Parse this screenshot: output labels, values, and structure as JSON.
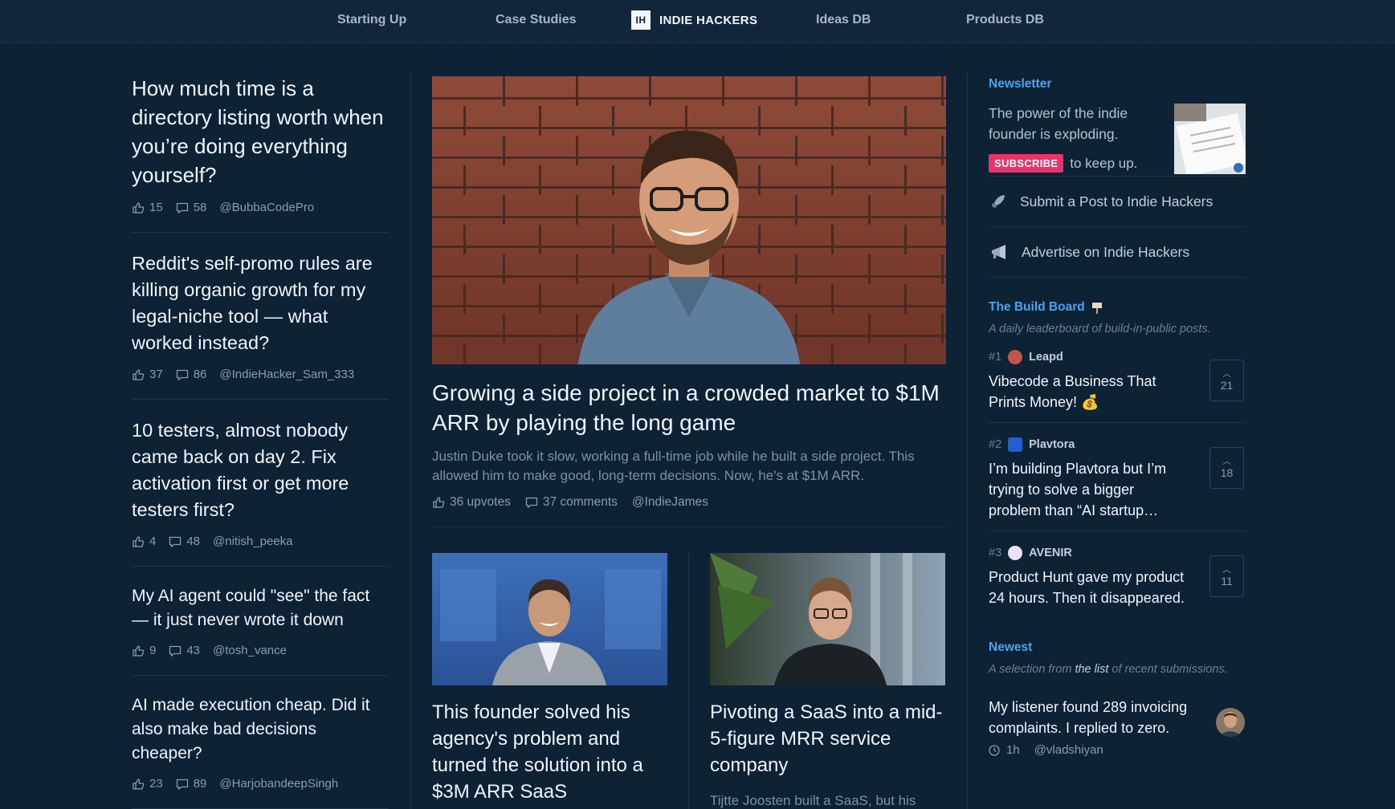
{
  "nav": {
    "starting_up": "Starting Up",
    "case_studies": "Case Studies",
    "brand_logo": "IH",
    "brand": "INDIE HACKERS",
    "ideas_db": "Ideas DB",
    "products_db": "Products DB"
  },
  "left_posts": [
    {
      "title": "How much time is a directory listing worth when you’re doing everything yourself?",
      "likes": "15",
      "comments": "58",
      "user": "@BubbaCodePro"
    },
    {
      "title": "Reddit's self-promo rules are killing organic growth for my legal-niche tool — what worked instead?",
      "likes": "37",
      "comments": "86",
      "user": "@IndieHacker_Sam_333"
    },
    {
      "title": "10 testers, almost nobody came back on day 2. Fix activation first or get more testers first?",
      "likes": "4",
      "comments": "48",
      "user": "@nitish_peeka"
    },
    {
      "title": "My AI agent could \"see\" the fact — it just never wrote it down",
      "likes": "9",
      "comments": "43",
      "user": "@tosh_vance"
    },
    {
      "title": "AI made execution cheap. Did it also make bad decisions cheaper?",
      "likes": "23",
      "comments": "89",
      "user": "@HarjobandeepSingh"
    }
  ],
  "hero": {
    "title": "Growing a side project in a crowded market to $1M ARR by playing the long game",
    "description": "Justin Duke took it slow, working a full-time job while he built a side project. This allowed him to make good, long-term decisions. Now, he's at $1M ARR.",
    "upvotes": "36 upvotes",
    "comments": "37 comments",
    "user": "@IndieJames"
  },
  "sub_cards": [
    {
      "title": "This founder solved his agency's problem and turned the solution into a $3M ARR SaaS"
    },
    {
      "title": "Pivoting a SaaS into a mid-5-figure MRR service company",
      "desc": "Tijtte Joosten built a SaaS, but his"
    }
  ],
  "sidebar": {
    "newsletter_label": "Newsletter",
    "newsletter_text": "The power of the indie founder is exploding.",
    "subscribe": "SUBSCRIBE",
    "keep_up": "to keep up.",
    "submit_link": "Submit a Post to Indie Hackers",
    "advertise_link": "Advertise on Indie Hackers",
    "build_board_label": "The Build Board",
    "build_board_sub": "A daily leaderboard of build-in-public posts.",
    "build_items": [
      {
        "rank": "#1",
        "name": "Leapd",
        "title": "Vibecode a Business That Prints Money! 💰",
        "votes": "21"
      },
      {
        "rank": "#2",
        "name": "Plavtora",
        "title": "I’m building Plavtora but I’m trying to solve a bigger problem than “AI startup…",
        "votes": "18"
      },
      {
        "rank": "#3",
        "name": "AVENIR",
        "title": "Product Hunt gave my product 24 hours. Then it disappeared.",
        "votes": "11"
      }
    ],
    "newest_label": "Newest",
    "newest_sub_a": "A selection from ",
    "newest_sub_link": "the list",
    "newest_sub_b": " of recent submissions.",
    "newest_item": {
      "title": "My listener found 289 invoicing complaints. I replied to zero.",
      "time": "1h",
      "user": "@vladshiyan"
    }
  },
  "colors": {
    "background": "#0e2236",
    "accent": "#4aa3f0",
    "subscribe": "#e8336b"
  }
}
